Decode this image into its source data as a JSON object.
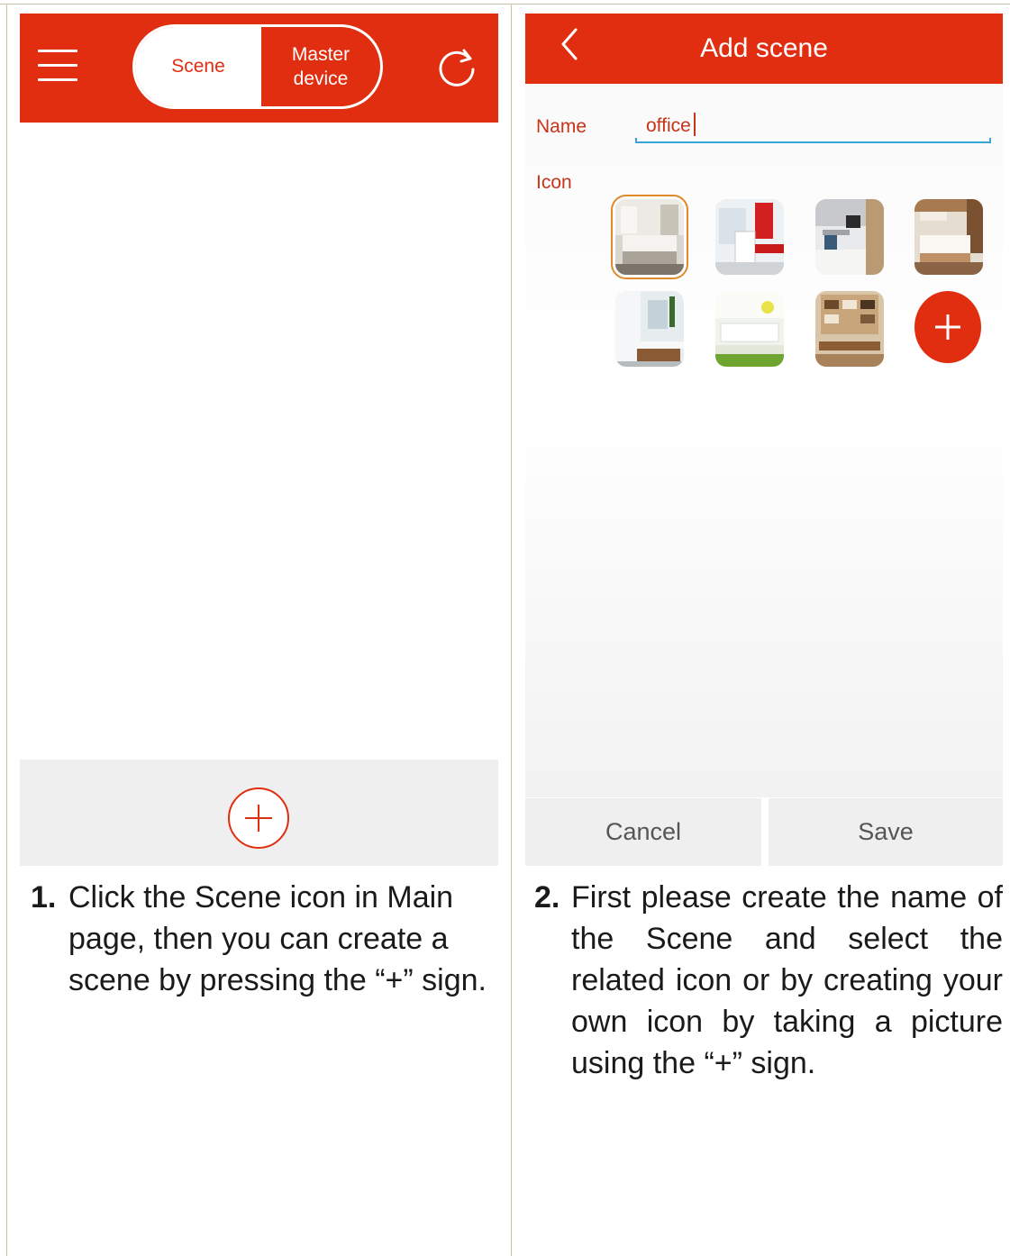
{
  "left_screen": {
    "tabs": {
      "scene": "Scene",
      "master_device": "Master\ndevice"
    },
    "icons": [
      "menu-icon",
      "refresh-icon",
      "add-circle-icon"
    ]
  },
  "right_screen": {
    "title": "Add scene",
    "name_label": "Name",
    "name_value": "office",
    "icon_label": "Icon",
    "thumbnails": [
      "bedroom-white",
      "living-room-red",
      "kitchen",
      "bedroom-wood",
      "bathroom",
      "living-room-bright",
      "study-shelves"
    ],
    "cancel_label": "Cancel",
    "save_label": "Save"
  },
  "steps": [
    {
      "num": "1.",
      "text": "Click the Scene icon in Main page, then you can create a scene by pressing the “+” sign."
    },
    {
      "num": "2.",
      "text": "First please create the name of the Scene and select the related icon or by creating your own icon by taking a picture using the “+” sign."
    }
  ],
  "colors": {
    "accent": "#e12d10",
    "input_underline": "#3aa3d8",
    "label": "#c73418"
  }
}
